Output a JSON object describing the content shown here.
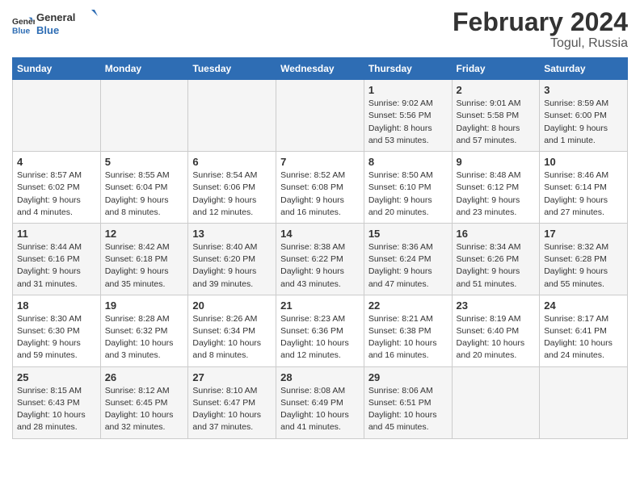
{
  "logo": {
    "text_general": "General",
    "text_blue": "Blue"
  },
  "title": "February 2024",
  "subtitle": "Togul, Russia",
  "days_of_week": [
    "Sunday",
    "Monday",
    "Tuesday",
    "Wednesday",
    "Thursday",
    "Friday",
    "Saturday"
  ],
  "weeks": [
    [
      {
        "day": "",
        "info": ""
      },
      {
        "day": "",
        "info": ""
      },
      {
        "day": "",
        "info": ""
      },
      {
        "day": "",
        "info": ""
      },
      {
        "day": "1",
        "info": "Sunrise: 9:02 AM\nSunset: 5:56 PM\nDaylight: 8 hours\nand 53 minutes."
      },
      {
        "day": "2",
        "info": "Sunrise: 9:01 AM\nSunset: 5:58 PM\nDaylight: 8 hours\nand 57 minutes."
      },
      {
        "day": "3",
        "info": "Sunrise: 8:59 AM\nSunset: 6:00 PM\nDaylight: 9 hours\nand 1 minute."
      }
    ],
    [
      {
        "day": "4",
        "info": "Sunrise: 8:57 AM\nSunset: 6:02 PM\nDaylight: 9 hours\nand 4 minutes."
      },
      {
        "day": "5",
        "info": "Sunrise: 8:55 AM\nSunset: 6:04 PM\nDaylight: 9 hours\nand 8 minutes."
      },
      {
        "day": "6",
        "info": "Sunrise: 8:54 AM\nSunset: 6:06 PM\nDaylight: 9 hours\nand 12 minutes."
      },
      {
        "day": "7",
        "info": "Sunrise: 8:52 AM\nSunset: 6:08 PM\nDaylight: 9 hours\nand 16 minutes."
      },
      {
        "day": "8",
        "info": "Sunrise: 8:50 AM\nSunset: 6:10 PM\nDaylight: 9 hours\nand 20 minutes."
      },
      {
        "day": "9",
        "info": "Sunrise: 8:48 AM\nSunset: 6:12 PM\nDaylight: 9 hours\nand 23 minutes."
      },
      {
        "day": "10",
        "info": "Sunrise: 8:46 AM\nSunset: 6:14 PM\nDaylight: 9 hours\nand 27 minutes."
      }
    ],
    [
      {
        "day": "11",
        "info": "Sunrise: 8:44 AM\nSunset: 6:16 PM\nDaylight: 9 hours\nand 31 minutes."
      },
      {
        "day": "12",
        "info": "Sunrise: 8:42 AM\nSunset: 6:18 PM\nDaylight: 9 hours\nand 35 minutes."
      },
      {
        "day": "13",
        "info": "Sunrise: 8:40 AM\nSunset: 6:20 PM\nDaylight: 9 hours\nand 39 minutes."
      },
      {
        "day": "14",
        "info": "Sunrise: 8:38 AM\nSunset: 6:22 PM\nDaylight: 9 hours\nand 43 minutes."
      },
      {
        "day": "15",
        "info": "Sunrise: 8:36 AM\nSunset: 6:24 PM\nDaylight: 9 hours\nand 47 minutes."
      },
      {
        "day": "16",
        "info": "Sunrise: 8:34 AM\nSunset: 6:26 PM\nDaylight: 9 hours\nand 51 minutes."
      },
      {
        "day": "17",
        "info": "Sunrise: 8:32 AM\nSunset: 6:28 PM\nDaylight: 9 hours\nand 55 minutes."
      }
    ],
    [
      {
        "day": "18",
        "info": "Sunrise: 8:30 AM\nSunset: 6:30 PM\nDaylight: 9 hours\nand 59 minutes."
      },
      {
        "day": "19",
        "info": "Sunrise: 8:28 AM\nSunset: 6:32 PM\nDaylight: 10 hours\nand 3 minutes."
      },
      {
        "day": "20",
        "info": "Sunrise: 8:26 AM\nSunset: 6:34 PM\nDaylight: 10 hours\nand 8 minutes."
      },
      {
        "day": "21",
        "info": "Sunrise: 8:23 AM\nSunset: 6:36 PM\nDaylight: 10 hours\nand 12 minutes."
      },
      {
        "day": "22",
        "info": "Sunrise: 8:21 AM\nSunset: 6:38 PM\nDaylight: 10 hours\nand 16 minutes."
      },
      {
        "day": "23",
        "info": "Sunrise: 8:19 AM\nSunset: 6:40 PM\nDaylight: 10 hours\nand 20 minutes."
      },
      {
        "day": "24",
        "info": "Sunrise: 8:17 AM\nSunset: 6:41 PM\nDaylight: 10 hours\nand 24 minutes."
      }
    ],
    [
      {
        "day": "25",
        "info": "Sunrise: 8:15 AM\nSunset: 6:43 PM\nDaylight: 10 hours\nand 28 minutes."
      },
      {
        "day": "26",
        "info": "Sunrise: 8:12 AM\nSunset: 6:45 PM\nDaylight: 10 hours\nand 32 minutes."
      },
      {
        "day": "27",
        "info": "Sunrise: 8:10 AM\nSunset: 6:47 PM\nDaylight: 10 hours\nand 37 minutes."
      },
      {
        "day": "28",
        "info": "Sunrise: 8:08 AM\nSunset: 6:49 PM\nDaylight: 10 hours\nand 41 minutes."
      },
      {
        "day": "29",
        "info": "Sunrise: 8:06 AM\nSunset: 6:51 PM\nDaylight: 10 hours\nand 45 minutes."
      },
      {
        "day": "",
        "info": ""
      },
      {
        "day": "",
        "info": ""
      }
    ]
  ]
}
